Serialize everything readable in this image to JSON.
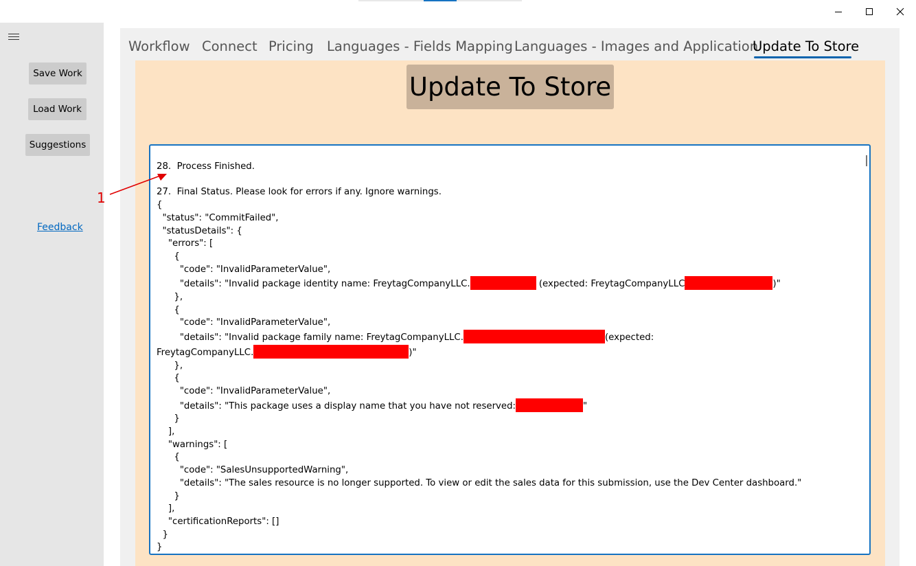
{
  "colors": {
    "window_bg": "#ffffff",
    "left_pane_bg": "#e6e6e6",
    "content_bg": "#f0f0f0",
    "panel_bg": "#fde3c4",
    "header_box_bg": "#c9b29a",
    "accent_blue": "#1673c2",
    "redaction": "#ff0000",
    "annotation": "#e00000"
  },
  "window_controls": {
    "minimize_icon": "minimize-icon",
    "maximize_icon": "maximize-icon",
    "close_icon": "close-icon"
  },
  "sidebar": {
    "menu_icon": "hamburger-menu-icon",
    "save_label": "Save Work",
    "load_label": "Load Work",
    "suggestions_label": "Suggestions",
    "feedback_label": "Feedback"
  },
  "tabs": [
    {
      "label": "Workflow",
      "active": false
    },
    {
      "label": "Connect",
      "active": false
    },
    {
      "label": "Pricing",
      "active": false
    },
    {
      "label": "Languages - Fields Mapping",
      "active": false
    },
    {
      "label": "Languages - Images and Application",
      "active": false
    },
    {
      "label": "Update To Store",
      "active": true
    }
  ],
  "page": {
    "header": "Update To Store"
  },
  "log": {
    "entry28": "28.  Process Finished.",
    "entry27": "27.  Final Status. Please look for errors if any. Ignore warnings.",
    "open_brace": "{",
    "status_line": "  \"status\": \"CommitFailed\",",
    "status_details_open": "  \"statusDetails\": {",
    "errors_open": "    \"errors\": [",
    "e1_open": "      {",
    "e1_code": "        \"code\": \"InvalidParameterValue\",",
    "e1_details_a": "        \"details\": \"Invalid package identity name: FreytagCompanyLLC.",
    "e1_details_b": " (expected: FreytagCompanyLLC",
    "e1_details_c": ")\"",
    "e1_close": "      },",
    "e2_open": "      {",
    "e2_code": "        \"code\": \"InvalidParameterValue\",",
    "e2_details_a": "        \"details\": \"Invalid package family name: FreytagCompanyLLC.",
    "e2_details_b": "(expected:",
    "e2_details_c": "FreytagCompanyLLC.",
    "e2_details_d": ")\"",
    "e2_close": "      },",
    "e3_open": "      {",
    "e3_code": "        \"code\": \"InvalidParameterValue\",",
    "e3_details_a": "        \"details\": \"This package uses a display name that you have not reserved:",
    "e3_details_b": "\"",
    "e3_close": "      }",
    "errors_close": "    ],",
    "warnings_open": "    \"warnings\": [",
    "w1_open": "      {",
    "w1_code": "        \"code\": \"SalesUnsupportedWarning\",",
    "w1_details": "        \"details\": \"The sales resource is no longer supported. To view or edit the sales data for this submission, use the Dev Center dashboard.\"",
    "w1_close": "      }",
    "warnings_close": "    ],",
    "cert_line": "    \"certificationReports\": []",
    "status_details_close": "  }",
    "close_brace": "}"
  },
  "annotation": {
    "label": "1"
  }
}
